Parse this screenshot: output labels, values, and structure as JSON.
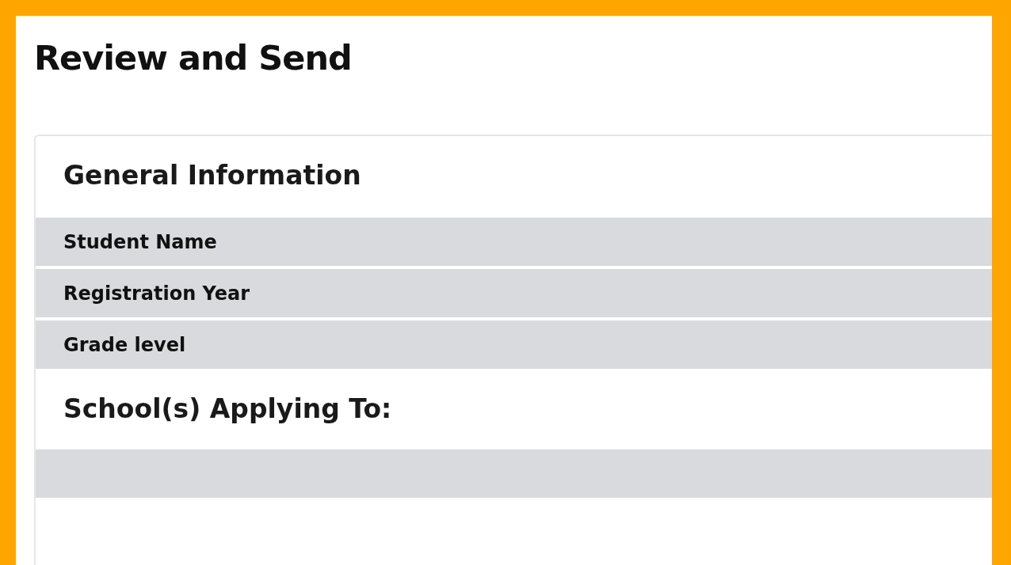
{
  "page": {
    "title": "Review and Send"
  },
  "sections": [
    {
      "heading": "General Information",
      "rows": [
        {
          "kind": "field",
          "label": "Student Name"
        },
        {
          "kind": "field",
          "label": "Registration Year"
        },
        {
          "kind": "field",
          "label": "Grade level"
        }
      ]
    },
    {
      "heading": "School(s) Applying To:",
      "rows": [
        {
          "kind": "empty"
        }
      ]
    }
  ]
}
